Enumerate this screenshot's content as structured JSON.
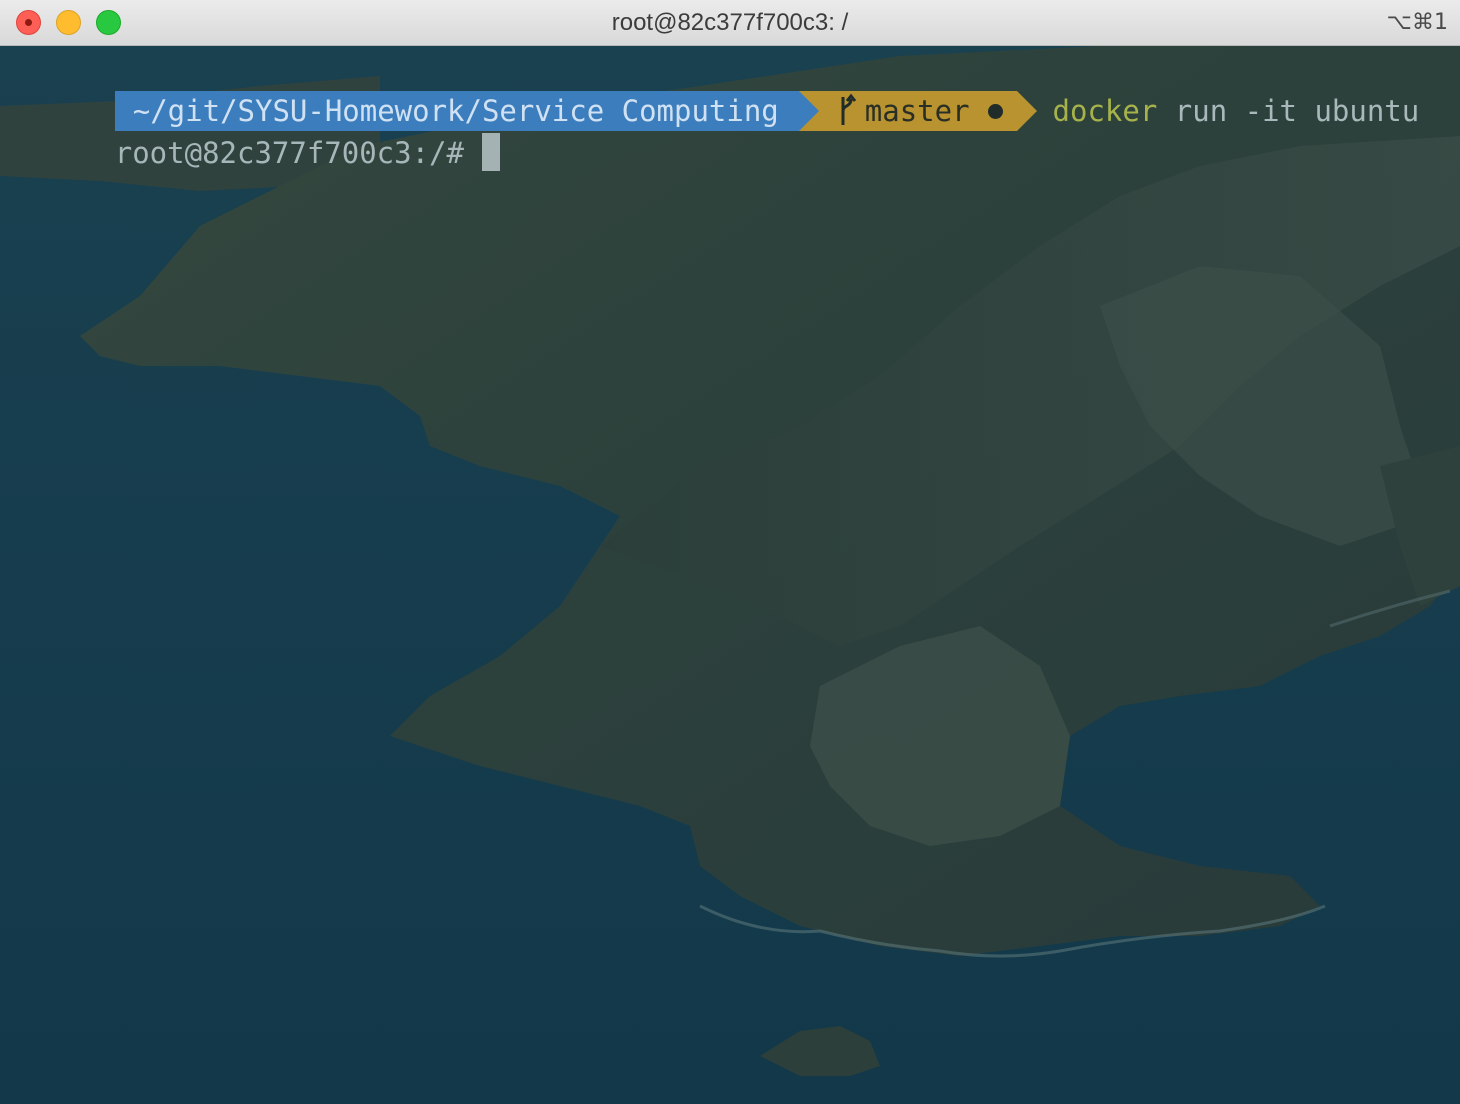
{
  "window": {
    "title": "root@82c377f700c3: /",
    "shortcut": "⌥⌘1"
  },
  "prompt": {
    "path": "~/git/SYSU-Homework/Service Computing",
    "branch": "master",
    "command": "docker",
    "args": "run -it ubuntu"
  },
  "shell": {
    "prompt": "root@82c377f700c3:/#"
  },
  "colors": {
    "path_segment": "#3c7ebd",
    "git_segment": "#b8932f",
    "command": "#a7b34a"
  },
  "icons": {
    "branch": "git-branch-icon",
    "dirty": "dirty-status-icon"
  }
}
